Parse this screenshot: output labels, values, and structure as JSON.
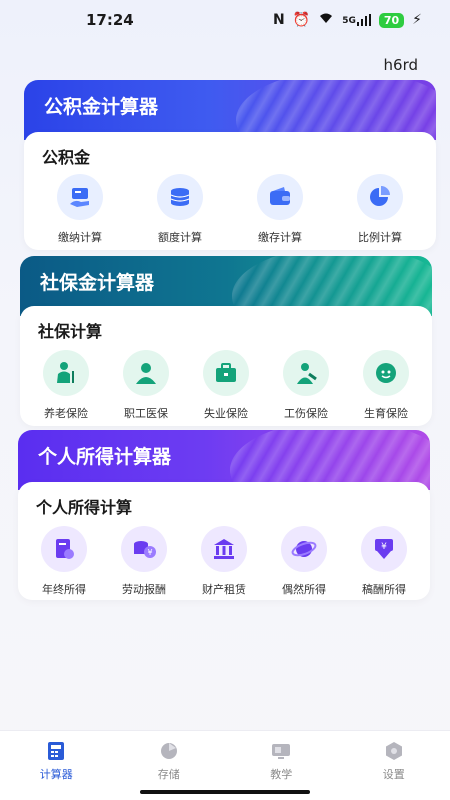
{
  "status_bar": {
    "time": "17:24",
    "battery": "70",
    "signal": "5G"
  },
  "user": {
    "name": "h6rd"
  },
  "sections": [
    {
      "banner_title": "公积金计算器",
      "card_title": "公积金",
      "items": [
        {
          "label": "缴纳计算",
          "icon": "card-hand-icon"
        },
        {
          "label": "额度计算",
          "icon": "coins-stack-icon"
        },
        {
          "label": "缴存计算",
          "icon": "wallet-icon"
        },
        {
          "label": "比例计算",
          "icon": "pie-chart-icon"
        }
      ]
    },
    {
      "banner_title": "社保金计算器",
      "card_title": "社保计算",
      "items": [
        {
          "label": "养老保险",
          "icon": "elderly-icon"
        },
        {
          "label": "职工医保",
          "icon": "worker-icon"
        },
        {
          "label": "失业保险",
          "icon": "briefcase-icon"
        },
        {
          "label": "工伤保险",
          "icon": "injury-icon"
        },
        {
          "label": "生育保险",
          "icon": "baby-icon"
        }
      ]
    },
    {
      "banner_title": "个人所得计算器",
      "card_title": "个人所得计算",
      "items": [
        {
          "label": "年终所得",
          "icon": "document-chart-icon"
        },
        {
          "label": "劳动报酬",
          "icon": "coins-yen-icon"
        },
        {
          "label": "财产租赁",
          "icon": "bank-icon"
        },
        {
          "label": "偶然所得",
          "icon": "orbit-icon"
        },
        {
          "label": "稿酬所得",
          "icon": "yen-download-icon"
        }
      ]
    }
  ],
  "tabbar": [
    {
      "label": "计算器",
      "icon": "calculator-icon",
      "active": true
    },
    {
      "label": "存储",
      "icon": "storage-icon",
      "active": false
    },
    {
      "label": "教学",
      "icon": "teaching-icon",
      "active": false
    },
    {
      "label": "设置",
      "icon": "settings-icon",
      "active": false
    }
  ],
  "colors": {
    "section1_banner": "#3d5af1",
    "section2_banner": "#0d6e8a",
    "section3_banner": "#6a3cf0",
    "accent": "#2a5bd7"
  }
}
